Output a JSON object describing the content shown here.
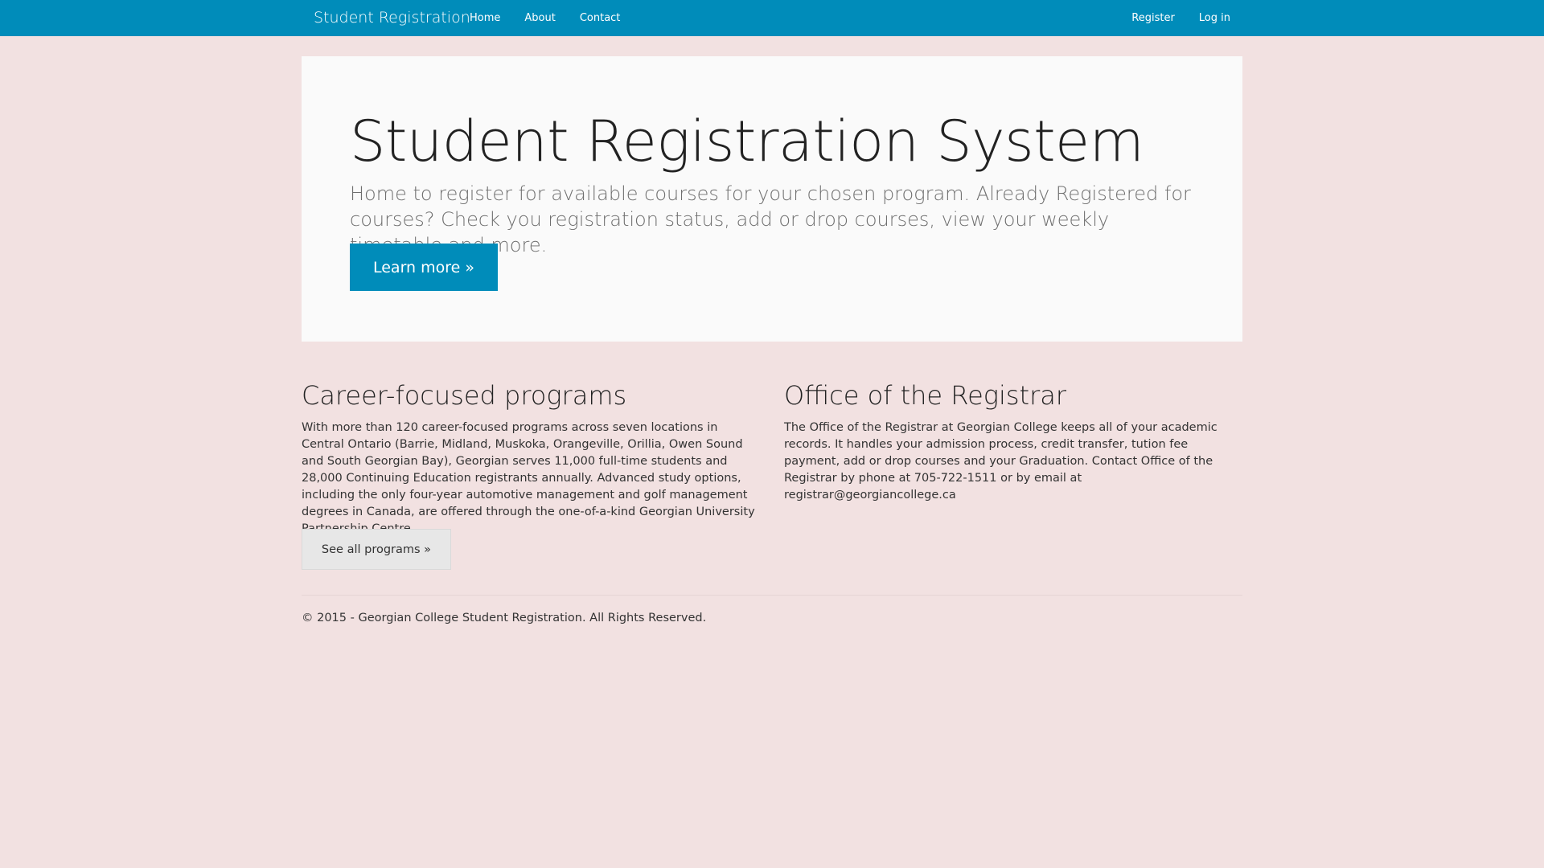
{
  "nav": {
    "brand": "Student Registration",
    "left_links": [
      "Home",
      "About",
      "Contact"
    ],
    "right_links": [
      "Register",
      "Log in"
    ]
  },
  "jumbotron": {
    "title": "Student Registration System",
    "lead": "Home to register for available courses for your chosen program. Already Registered for courses? Check you registration status, add or drop courses, view your weekly timetable and more.",
    "button": "Learn more »"
  },
  "programs": {
    "heading": "Career-focused programs",
    "body": "With more than 120 career-focused programs across seven locations in Central Ontario (Barrie, Midland, Muskoka, Orangeville, Orillia, Owen Sound and South Georgian Bay), Georgian serves 11,000 full-time students and 28,000 Continuing Education registrants annually. Advanced study options, including the only four-year automotive management and golf management degrees in Canada, are offered through the one-of-a-kind Georgian University Partnership Centre.",
    "button": "See all programs »"
  },
  "registrar": {
    "heading": "Office of the Registrar",
    "body": "The Office of the Registrar at Georgian College keeps all of your academic records. It handles your admission process, credit transfer, tution fee payment, add or drop courses and your Graduation. Contact Office of the Registrar by phone at 705-722-1511 or by email at registrar@georgiancollege.ca"
  },
  "footer": {
    "copyright": "© 2015 - Georgian College Student Registration. All Rights Reserved."
  },
  "colors": {
    "navbar": "#008cba",
    "page_background": "#f2e1e1",
    "jumbotron_background": "#fafafa",
    "primary_button": "#008cba",
    "default_button": "#e7e7e7"
  }
}
